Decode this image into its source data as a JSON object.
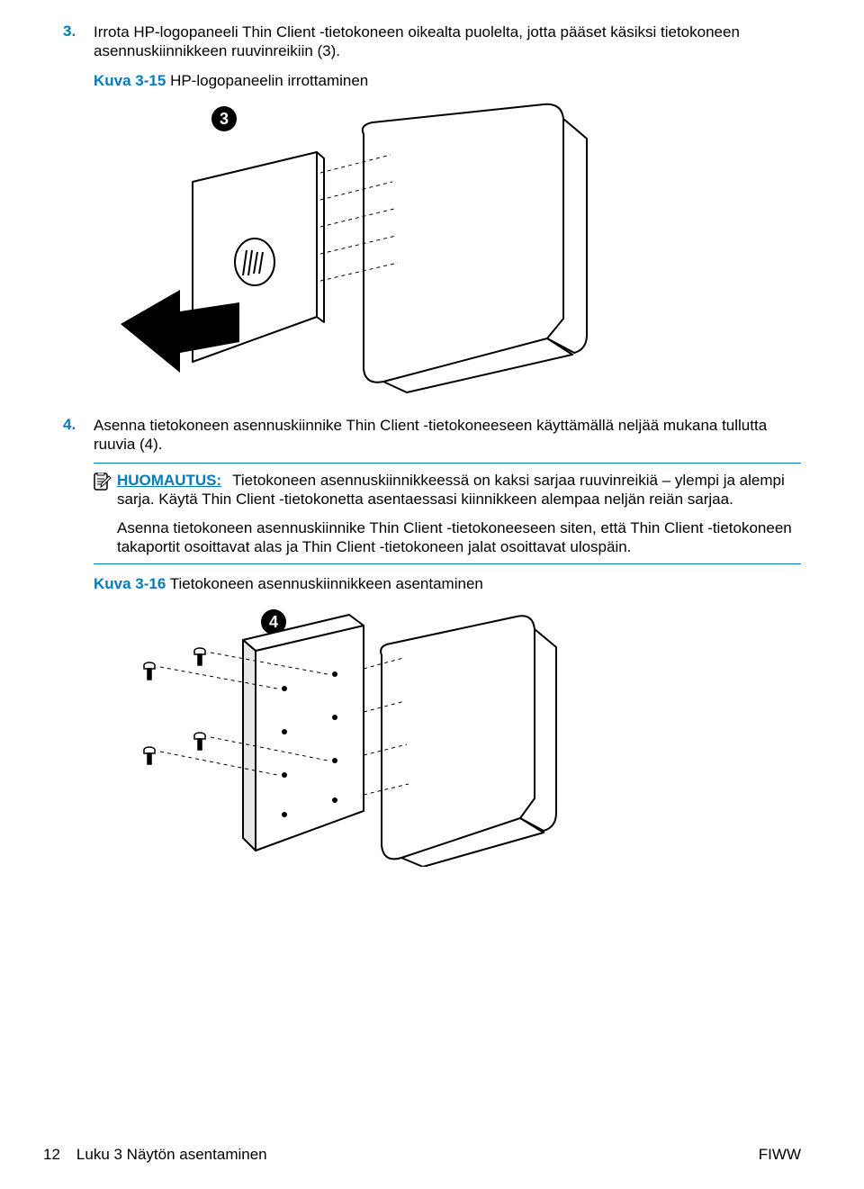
{
  "step3": {
    "marker": "3.",
    "text": "Irrota HP-logopaneeli Thin Client -tietokoneen oikealta puolelta, jotta pääset käsiksi tietokoneen asennuskiinnikkeen ruuvinreikiin (3)."
  },
  "figure315": {
    "label": "Kuva 3-15",
    "caption": "HP-logopaneelin irrottaminen",
    "callout": "3"
  },
  "step4": {
    "marker": "4.",
    "text": "Asenna tietokoneen asennuskiinnike Thin Client -tietokoneeseen käyttämällä neljää mukana tullutta ruuvia (4)."
  },
  "note": {
    "label": "HUOMAUTUS:",
    "para1": "Tietokoneen asennuskiinnikkeessä on kaksi sarjaa ruuvinreikiä – ylempi ja alempi sarja. Käytä Thin Client -tietokonetta asentaessasi kiinnikkeen alempaa neljän reiän sarjaa.",
    "para2": "Asenna tietokoneen asennuskiinnike Thin Client -tietokoneeseen siten, että Thin Client -tietokoneen takaportit osoittavat alas ja Thin Client -tietokoneen jalat osoittavat ulospäin."
  },
  "figure316": {
    "label": "Kuva 3-16",
    "caption": "Tietokoneen asennuskiinnikkeen asentaminen",
    "callout": "4"
  },
  "footer": {
    "page": "12",
    "chapter": "Luku 3   Näytön asentaminen",
    "lang": "FIWW"
  }
}
